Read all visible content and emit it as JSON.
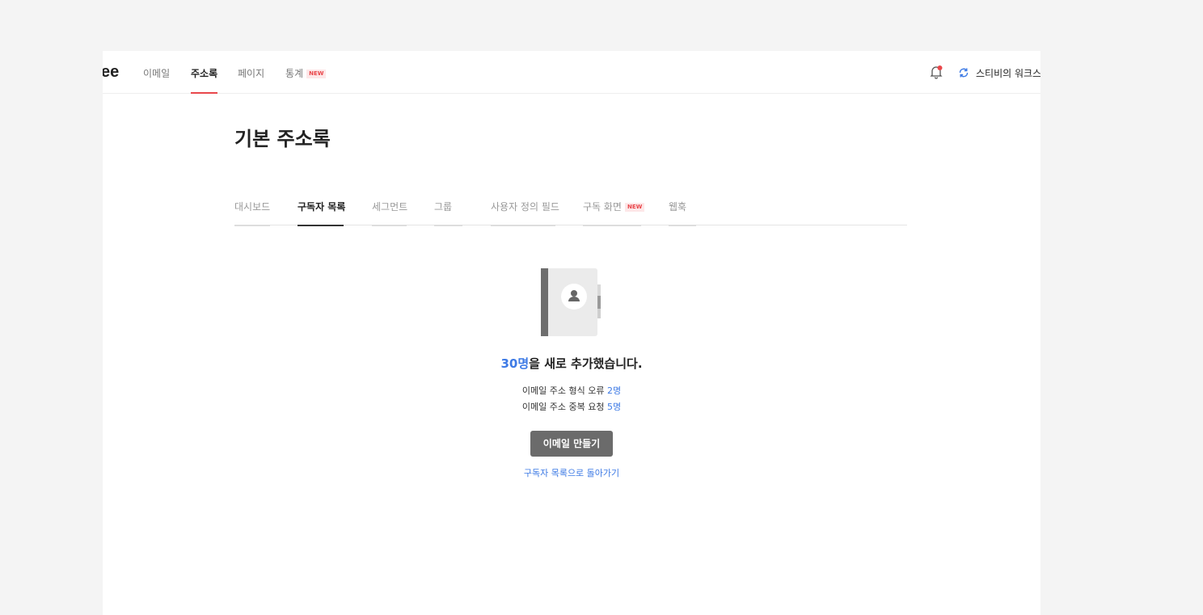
{
  "header": {
    "logo_text": "ee",
    "nav": [
      {
        "label": "이메일"
      },
      {
        "label": "주소록"
      },
      {
        "label": "페이지"
      },
      {
        "label": "통계",
        "badge": "NEW"
      }
    ],
    "active_nav": "주소록",
    "workspace_label": "스티비의 워크스",
    "notification_dot": true
  },
  "page": {
    "title": "기본 주소록"
  },
  "tabs": [
    {
      "label": "대시보드"
    },
    {
      "label": "구독자 목록"
    },
    {
      "label": "세그먼트"
    },
    {
      "label": "그룹"
    },
    {
      "label": "사용자 정의 필드"
    },
    {
      "label": "구독 화면",
      "badge": "NEW"
    },
    {
      "label": "웹훅"
    }
  ],
  "active_tab": "구독자 목록",
  "result": {
    "added_count": "30명",
    "added_text": "을 새로 추가했습니다.",
    "format_error_label": "이메일 주소 형식 오류 ",
    "format_error_count": "2명",
    "duplicate_label": "이메일 주소 중복 요청 ",
    "duplicate_count": "5명",
    "create_email_button": "이메일 만들기",
    "back_link": "구독자 목록으로 돌아가기"
  },
  "colors": {
    "accent_red": "#e9474b",
    "link_blue": "#3d7ae5",
    "button_gray": "#6b6b6b",
    "background": "#f4f4f4"
  },
  "icons": [
    "bell-icon",
    "refresh-icon",
    "address-book-icon",
    "person-icon"
  ]
}
